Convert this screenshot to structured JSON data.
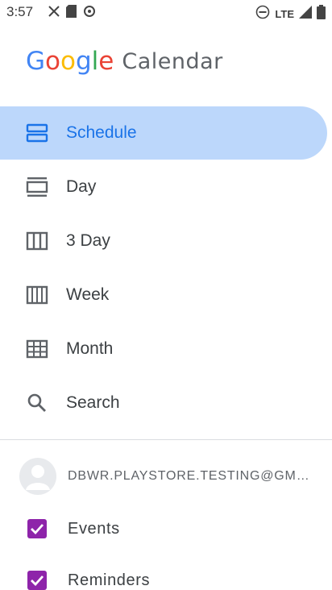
{
  "status_bar": {
    "time": "3:57",
    "network": "LTE"
  },
  "logo": {
    "letters": [
      "G",
      "o",
      "o",
      "g",
      "l",
      "e"
    ],
    "letter_colors": [
      "#4285f4",
      "#ea4335",
      "#fbbc04",
      "#4285f4",
      "#34a853",
      "#ea4335"
    ],
    "product": "Calendar"
  },
  "nav": {
    "items": [
      {
        "label": "Schedule",
        "icon": "schedule-view-icon",
        "selected": true
      },
      {
        "label": "Day",
        "icon": "day-view-icon",
        "selected": false
      },
      {
        "label": "3 Day",
        "icon": "three-day-view-icon",
        "selected": false
      },
      {
        "label": "Week",
        "icon": "week-view-icon",
        "selected": false
      },
      {
        "label": "Month",
        "icon": "month-view-icon",
        "selected": false
      },
      {
        "label": "Search",
        "icon": "search-icon",
        "selected": false
      }
    ]
  },
  "account": {
    "email": "DBWR.PLAYSTORE.TESTING@GMAIL.COM"
  },
  "calendars": [
    {
      "label": "Events",
      "checked": true,
      "color": "#8e24aa"
    },
    {
      "label": "Reminders",
      "checked": true,
      "color": "#8e24aa"
    }
  ],
  "colors": {
    "accent": "#1a73e8",
    "selected_bg": "#bcd7fb"
  }
}
